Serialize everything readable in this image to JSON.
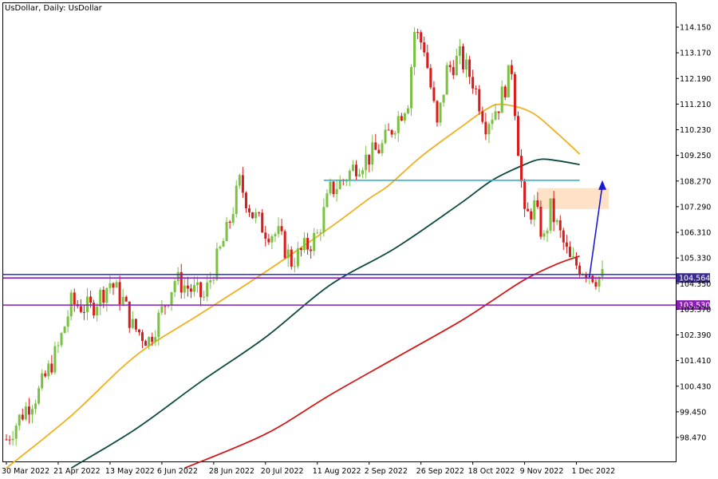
{
  "chart_title": "UsDollar, Daily:  UsDollar",
  "chart_data": {
    "type": "candlestick",
    "title": "UsDollar, Daily:  UsDollar",
    "xlabel": "",
    "ylabel": "",
    "y_ticks": [
      "114.150",
      "113.170",
      "112.190",
      "111.210",
      "110.230",
      "109.250",
      "108.270",
      "107.290",
      "106.310",
      "105.330",
      "104.350",
      "103.370",
      "102.390",
      "101.410",
      "100.430",
      "99.450",
      "98.470"
    ],
    "ylim": [
      97.3,
      115.4
    ],
    "x_ticks": [
      {
        "label": "30 Mar 2022",
        "i": 0
      },
      {
        "label": "21 Apr 2022",
        "i": 16
      },
      {
        "label": "13 May 2022",
        "i": 32
      },
      {
        "label": "6 Jun 2022",
        "i": 48
      },
      {
        "label": "28 Jun 2022",
        "i": 64
      },
      {
        "label": "20 Jul 2022",
        "i": 80
      },
      {
        "label": "11 Aug 2022",
        "i": 96
      },
      {
        "label": "2 Sep 2022",
        "i": 112
      },
      {
        "label": "26 Sep 2022",
        "i": 128
      },
      {
        "label": "18 Oct 2022",
        "i": 144
      },
      {
        "label": "9 Nov 2022",
        "i": 160
      },
      {
        "label": "1 Dec 2022",
        "i": 176
      }
    ],
    "candle_count": 185,
    "close_path": [
      [
        0,
        98.4
      ],
      [
        6,
        99.6
      ],
      [
        10,
        100.2
      ],
      [
        16,
        101.9
      ],
      [
        20,
        103.6
      ],
      [
        26,
        103.4
      ],
      [
        32,
        104.4
      ],
      [
        36,
        103.7
      ],
      [
        39,
        102.7
      ],
      [
        44,
        102.2
      ],
      [
        48,
        103.3
      ],
      [
        52,
        104.5
      ],
      [
        56,
        104.2
      ],
      [
        61,
        103.8
      ],
      [
        64,
        104.9
      ],
      [
        68,
        106.3
      ],
      [
        72,
        108.2
      ],
      [
        76,
        107.0
      ],
      [
        80,
        106.4
      ],
      [
        84,
        106.2
      ],
      [
        88,
        105.2
      ],
      [
        93,
        105.8
      ],
      [
        96,
        106.2
      ],
      [
        100,
        107.9
      ],
      [
        104,
        108.3
      ],
      [
        108,
        108.9
      ],
      [
        112,
        109.2
      ],
      [
        116,
        109.6
      ],
      [
        120,
        110.5
      ],
      [
        124,
        111.4
      ],
      [
        126,
        114.0
      ],
      [
        129,
        113.4
      ],
      [
        133,
        110.3
      ],
      [
        136,
        112.5
      ],
      [
        140,
        113.0
      ],
      [
        144,
        112.1
      ],
      [
        148,
        110.5
      ],
      [
        152,
        111.2
      ],
      [
        156,
        112.6
      ],
      [
        158,
        109.6
      ],
      [
        160,
        106.8
      ],
      [
        163,
        107.3
      ],
      [
        166,
        106.0
      ],
      [
        168,
        107.2
      ],
      [
        171,
        106.2
      ],
      [
        174,
        105.2
      ],
      [
        177,
        105.0
      ],
      [
        180,
        104.8
      ],
      [
        182,
        104.6
      ]
    ],
    "series": [
      {
        "name": "",
        "type": "moving-average",
        "color": "#f2b01e",
        "points": [
          [
            0,
            97.3
          ],
          [
            20,
            99.3
          ],
          [
            40,
            101.6
          ],
          [
            60,
            103.2
          ],
          [
            80,
            104.8
          ],
          [
            100,
            106.5
          ],
          [
            112,
            107.6
          ],
          [
            118,
            108.1
          ],
          [
            128,
            109.2
          ],
          [
            140,
            110.3
          ],
          [
            148,
            111.0
          ],
          [
            153,
            111.2
          ],
          [
            162,
            110.9
          ],
          [
            170,
            110.1
          ],
          [
            177,
            109.3
          ]
        ]
      },
      {
        "name": "",
        "type": "moving-average",
        "color": "#0d4a40",
        "points": [
          [
            20,
            97.3
          ],
          [
            40,
            98.8
          ],
          [
            60,
            100.6
          ],
          [
            80,
            102.3
          ],
          [
            100,
            104.3
          ],
          [
            120,
            105.7
          ],
          [
            140,
            107.4
          ],
          [
            150,
            108.3
          ],
          [
            160,
            108.9
          ],
          [
            165,
            109.1
          ],
          [
            170,
            109.05
          ],
          [
            177,
            108.9
          ]
        ]
      },
      {
        "name": "",
        "type": "moving-average",
        "color": "#d11a1a",
        "points": [
          [
            55,
            97.3
          ],
          [
            80,
            98.6
          ],
          [
            100,
            100.1
          ],
          [
            120,
            101.5
          ],
          [
            140,
            102.9
          ],
          [
            150,
            103.7
          ],
          [
            160,
            104.5
          ],
          [
            170,
            105.1
          ],
          [
            177,
            105.4
          ]
        ]
      }
    ],
    "horizontal_levels": [
      {
        "value": 104.564,
        "color": "#8b1fb5",
        "label": "104.564",
        "badge_color": "#3a2a8c"
      },
      {
        "value": 104.7,
        "color": "#3a3ad0",
        "label": "",
        "badge_color": ""
      },
      {
        "value": 103.53,
        "color": "#8b1fb5",
        "label": "103.530",
        "badge_color": "#8b1fb5"
      },
      {
        "value": 108.3,
        "color": "#2bb6d8",
        "label": "",
        "badge_color": "",
        "from_i": 98,
        "to_i": 177
      }
    ],
    "zone": {
      "from_i": 164,
      "to_i": 186,
      "y_low": 107.2,
      "y_high": 108.0,
      "color": "#fde2c8"
    },
    "projection_arrow": {
      "from": [
        180,
        104.6
      ],
      "to": [
        184,
        108.3
      ],
      "color": "#1a1ad6"
    },
    "colors": {
      "bull": "#7ac142",
      "bear": "#d81b1b",
      "axis": "#000000",
      "background": "#ffffff"
    }
  }
}
